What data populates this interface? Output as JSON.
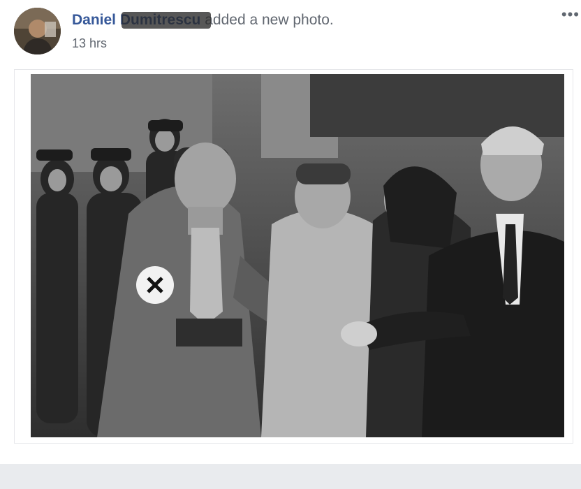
{
  "post": {
    "author_name": "Daniel Dumitrescu",
    "action_text": "added a new photo.",
    "timestamp": "13 hrs",
    "more_label": "•••"
  }
}
